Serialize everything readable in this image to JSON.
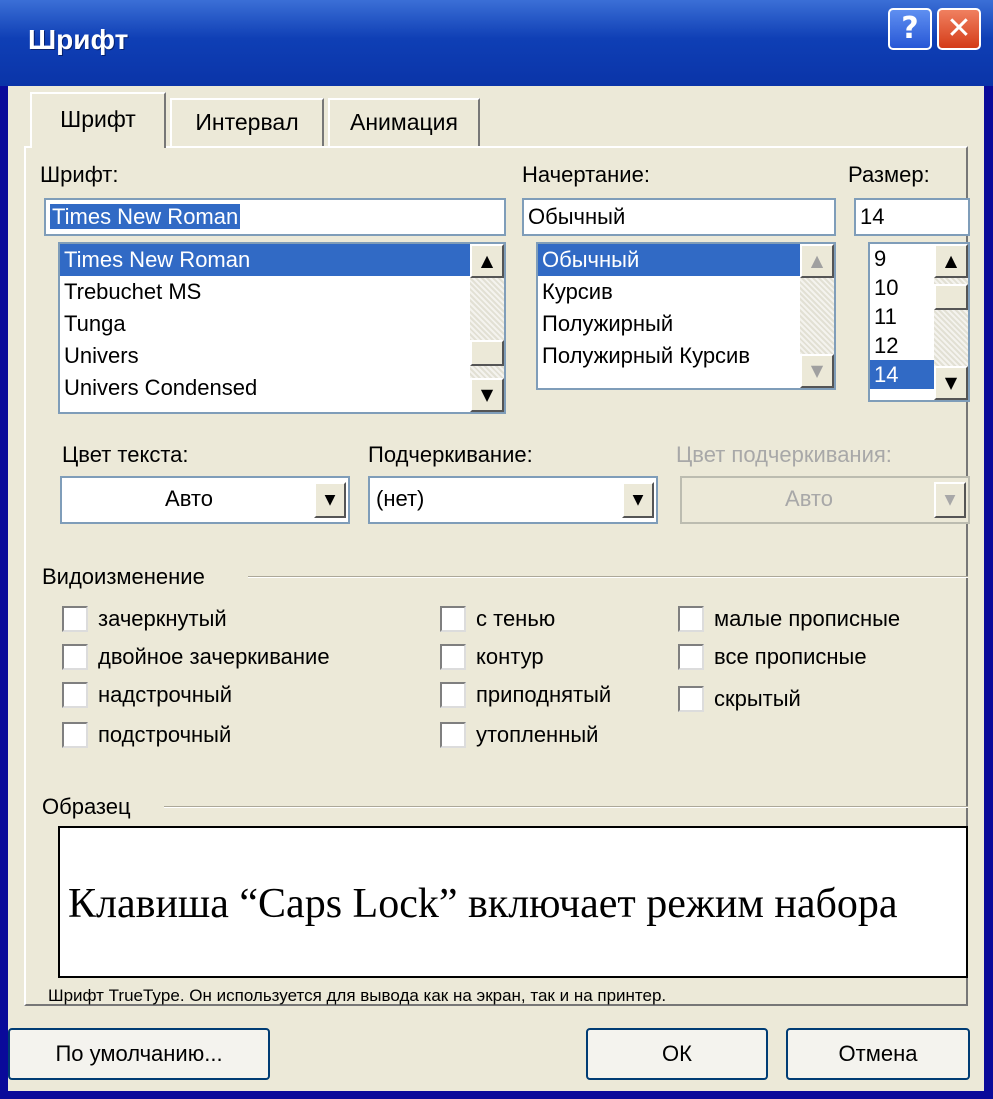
{
  "window": {
    "title": "Шрифт",
    "help_glyph": "?",
    "close_glyph": "✕"
  },
  "tabs": [
    {
      "label": "Шрифт",
      "active": true
    },
    {
      "label": "Интервал",
      "active": false
    },
    {
      "label": "Анимация",
      "active": false
    }
  ],
  "font": {
    "label": "Шрифт:",
    "value": "Times New Roman",
    "items": [
      "Times New Roman",
      "Trebuchet MS",
      "Tunga",
      "Univers",
      "Univers Condensed"
    ]
  },
  "style": {
    "label": "Начертание:",
    "value": "Обычный",
    "items": [
      "Обычный",
      "Курсив",
      "Полужирный",
      "Полужирный Курсив"
    ]
  },
  "size": {
    "label": "Размер:",
    "value": "14",
    "items": [
      "9",
      "10",
      "11",
      "12",
      "14"
    ]
  },
  "text_color": {
    "label": "Цвет текста:",
    "value": "Авто"
  },
  "underline": {
    "label": "Подчеркивание:",
    "value": "(нет)"
  },
  "underline_color": {
    "label": "Цвет подчеркивания:",
    "value": "Авто"
  },
  "effects": {
    "label": "Видоизменение",
    "col1": [
      "зачеркнутый",
      "двойное зачеркивание",
      "надстрочный",
      "подстрочный"
    ],
    "col2": [
      "с тенью",
      "контур",
      "приподнятый",
      "утопленный"
    ],
    "col3": [
      "малые прописные",
      "все прописные",
      "скрытый"
    ]
  },
  "sample": {
    "label": "Образец",
    "text": "Клавиша “Caps Lock” включает режим набора",
    "note": "Шрифт TrueType. Он используется для вывода как на экран, так и на принтер."
  },
  "buttons": {
    "default": "По умолчанию...",
    "ok": "ОК",
    "cancel": "Отмена"
  }
}
